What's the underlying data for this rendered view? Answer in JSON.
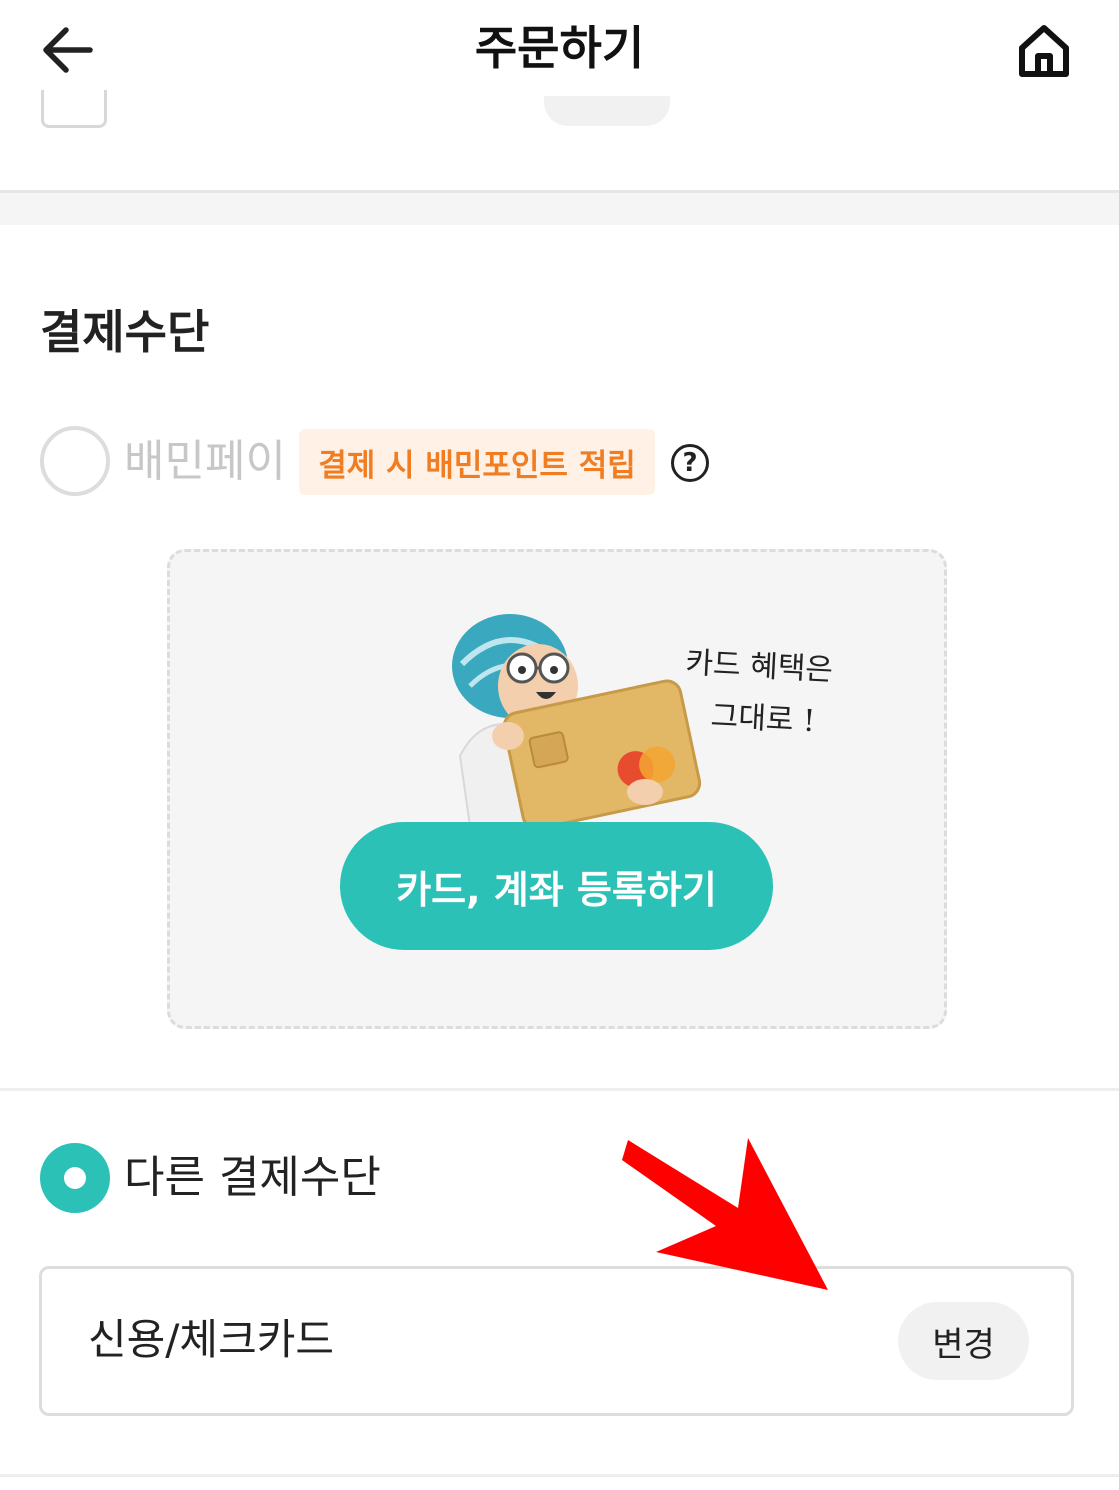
{
  "header": {
    "title": "주문하기",
    "back_icon": "arrow-left-icon",
    "home_icon": "home-icon"
  },
  "payment": {
    "section_title": "결제수단",
    "baemin_pay": {
      "label": "배민페이",
      "selected": false,
      "promo_badge": "결제 시 배민포인트 적립",
      "help_icon_glyph": "?"
    },
    "card_register": {
      "illustration_text_line1": "카드 혜택은",
      "illustration_text_line2": "그대로 !",
      "button_label": "카드, 계좌 등록하기"
    },
    "other_method": {
      "label": "다른 결제수단",
      "selected": true,
      "current_method": "신용/체크카드",
      "change_label": "변경"
    }
  },
  "colors": {
    "accent": "#2cc1b7",
    "promo_text": "#f07d22",
    "promo_bg": "#fff1e6",
    "annotation_arrow": "#ff0000"
  }
}
